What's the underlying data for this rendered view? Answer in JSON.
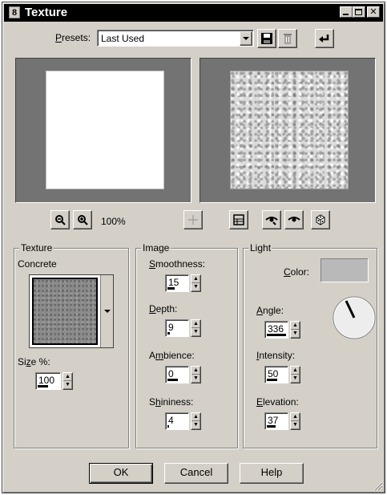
{
  "window": {
    "title": "Texture",
    "app_icon": "8",
    "controls": [
      "minimize-icon",
      "maximize-icon",
      "close-icon"
    ]
  },
  "presets": {
    "label_prefix": "P",
    "label_rest": "resets:",
    "value": "Last Used",
    "buttons": [
      "save-preset-icon",
      "delete-preset-icon",
      "reset-icon"
    ]
  },
  "zoom": {
    "value": "100%",
    "buttons": [
      "zoom-out-icon",
      "zoom-in-icon",
      "move-crosshair-icon"
    ],
    "view_buttons": [
      "proof-toggle-icon",
      "randomize-eye-icon",
      "auto-proof-eye-icon",
      "dice-icon"
    ]
  },
  "texture": {
    "group_title": "Texture",
    "name": "Concrete",
    "size_label": "Size %:",
    "size_value": "100",
    "size_fill": 0.5
  },
  "image": {
    "group_title": "Image",
    "fields": [
      {
        "label": "Smoothness:",
        "value": "15",
        "fill": 0.15
      },
      {
        "label": "Depth:",
        "value": "9",
        "fill": 0.09
      },
      {
        "label": "Ambience:",
        "value": "0",
        "fill": 0.5
      },
      {
        "label": "Shininess:",
        "value": "4",
        "fill": 0.04
      }
    ]
  },
  "light": {
    "group_title": "Light",
    "color_label": "Color:",
    "color": "#b9b9b9",
    "angle_label": "Angle:",
    "angle_value": "336",
    "angle_fill": 0.93,
    "intensity_label": "Intensity:",
    "intensity_value": "50",
    "intensity_fill": 0.5,
    "elevation_label": "Elevation:",
    "elevation_value": "37",
    "elevation_fill": 0.41
  },
  "footer": {
    "ok": "OK",
    "cancel": "Cancel",
    "help": "Help"
  }
}
